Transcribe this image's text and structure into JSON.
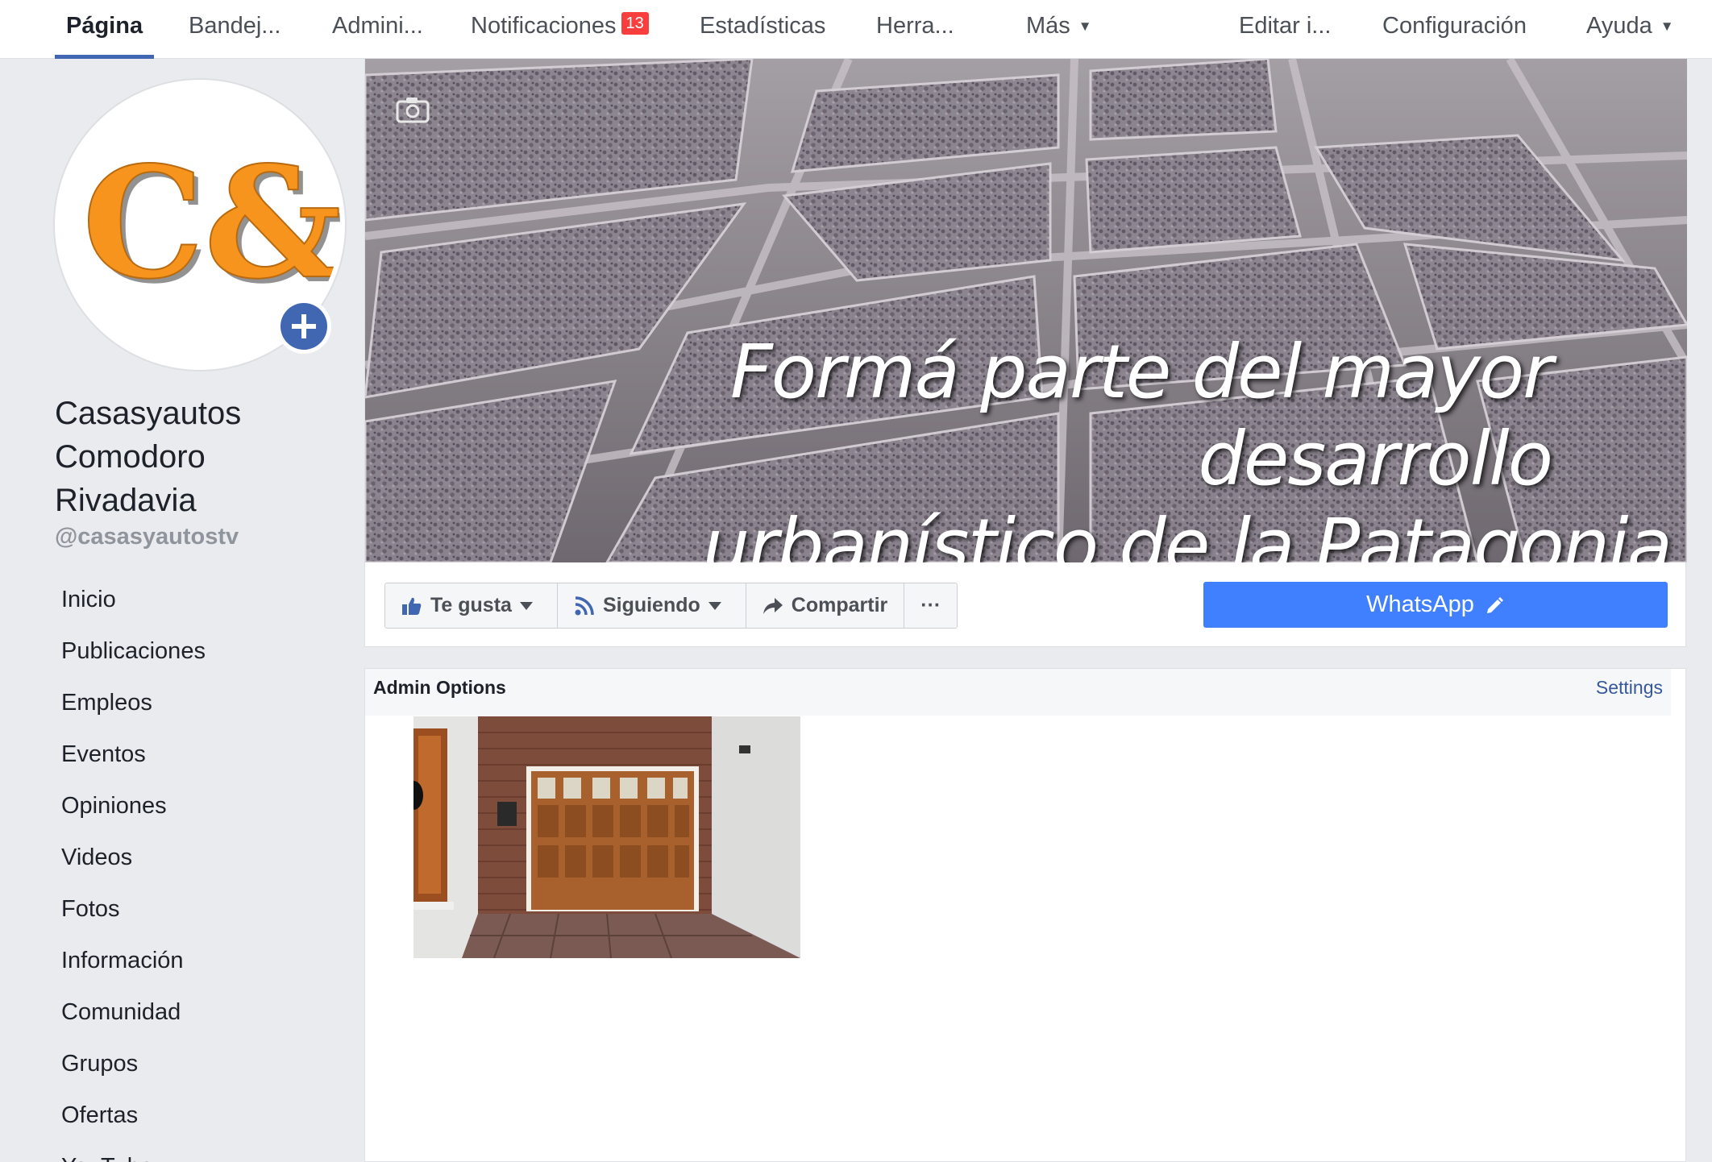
{
  "nav": {
    "items": [
      {
        "label": "Página",
        "active": true
      },
      {
        "label": "Bandej..."
      },
      {
        "label": "Admini..."
      },
      {
        "label": "Notificaciones",
        "badge": "13"
      },
      {
        "label": "Estadísticas"
      },
      {
        "label": "Herra..."
      },
      {
        "label": "Más"
      },
      {
        "label": "Editar i..."
      },
      {
        "label": "Configuración"
      },
      {
        "label": "Ayuda"
      }
    ]
  },
  "profile": {
    "logo_text": "C&A",
    "name_lines": [
      "Casasyautos",
      "Comodoro",
      "Rivadavia"
    ],
    "handle": "@casasyautostv"
  },
  "left_menu": [
    "Inicio",
    "Publicaciones",
    "Empleos",
    "Eventos",
    "Opiniones",
    "Videos",
    "Fotos",
    "Información",
    "Comunidad",
    "Grupos",
    "Ofertas",
    "YouTube"
  ],
  "cover": {
    "line1": "Formá parte del mayor desarrollo",
    "line2": "urbanístico de la Patagonia"
  },
  "actions": {
    "like": "Te gusta",
    "following": "Siguiendo",
    "share": "Compartir",
    "more": "···",
    "cta": "WhatsApp"
  },
  "admin": {
    "title": "Admin Options",
    "settings": "Settings"
  },
  "colors": {
    "brand_blue": "#4267b2",
    "cta_blue": "#4080ff",
    "badge_red": "#fa3e3e",
    "logo_orange": "#f7941d"
  }
}
